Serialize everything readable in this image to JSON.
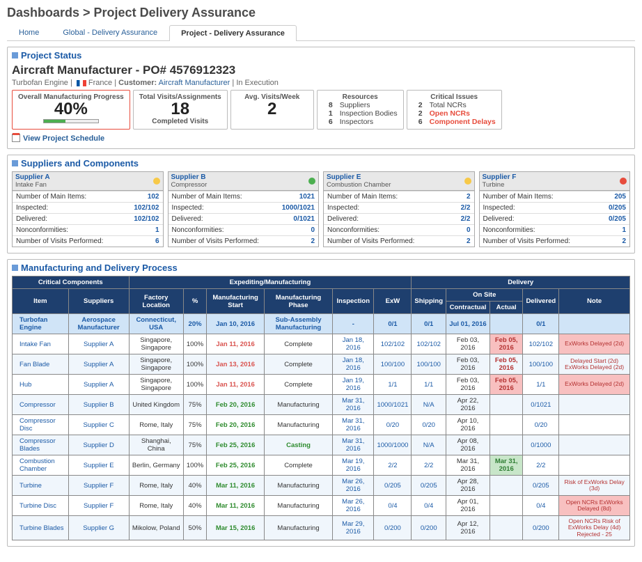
{
  "breadcrumb": "Dashboards > Project Delivery Assurance",
  "tabs": [
    {
      "label": "Home"
    },
    {
      "label": "Global - Delivery Assurance"
    },
    {
      "label": "Project - Delivery Assurance"
    }
  ],
  "sections": {
    "status_title": "Project Status",
    "suppliers_title": "Suppliers and Components",
    "process_title": "Manufacturing and Delivery Process"
  },
  "project": {
    "title": "Aircraft Manufacturer - PO# 4576912323",
    "engine": "Turbofan Engine",
    "country": "France",
    "cust_lbl": "Customer:",
    "customer": "Aircraft Manufacturer",
    "state": "In Execution",
    "schedule_link": "View Project Schedule"
  },
  "kpi": {
    "prog_lbl": "Overall Manufacturing Progress",
    "prog_val": "40%",
    "visits_lbl": "Total Visits/Assignments",
    "visits_val": "18",
    "visits_sub": "Completed Visits",
    "avg_lbl": "Avg. Visits/Week",
    "avg_val": "2",
    "res_lbl": "Resources",
    "res": [
      {
        "n": "8",
        "t": "Suppliers"
      },
      {
        "n": "1",
        "t": "Inspection Bodies"
      },
      {
        "n": "6",
        "t": "Inspectors"
      }
    ],
    "crit_lbl": "Critical Issues",
    "crit": [
      {
        "n": "2",
        "t": "Total NCRs",
        "red": false
      },
      {
        "n": "2",
        "t": "Open NCRs",
        "red": true
      },
      {
        "n": "6",
        "t": "Component Delays",
        "red": true
      }
    ]
  },
  "sup_labels": {
    "main": "Number of Main Items:",
    "insp": "Inspected:",
    "deliv": "Delivered:",
    "nonc": "Nonconformities:",
    "visits": "Number of Visits Performed:"
  },
  "suppliers": [
    {
      "name": "Supplier A",
      "comp": "Intake Fan",
      "dot": "y",
      "main": "102",
      "insp": "102/102",
      "deliv": "102/102",
      "nonc": "1",
      "visits": "6"
    },
    {
      "name": "Supplier B",
      "comp": "Compressor",
      "dot": "g",
      "main": "1021",
      "insp": "1000/1021",
      "deliv": "0/1021",
      "nonc": "0",
      "visits": "2"
    },
    {
      "name": "Supplier E",
      "comp": "Combustion Chamber",
      "dot": "y",
      "main": "2",
      "insp": "2/2",
      "deliv": "2/2",
      "nonc": "0",
      "visits": "2"
    },
    {
      "name": "Supplier F",
      "comp": "Turbine",
      "dot": "r",
      "main": "205",
      "insp": "0/205",
      "deliv": "0/205",
      "nonc": "1",
      "visits": "2"
    }
  ],
  "mdp_headers": {
    "g_crit": "Critical Components",
    "g_exp": "Expediting/Manufacturing",
    "g_del": "Delivery",
    "item": "Item",
    "sup": "Suppliers",
    "loc": "Factory Location",
    "pct": "%",
    "mstart": "Manufacturing Start",
    "mphase": "Manufacturing Phase",
    "insp": "Inspection",
    "exw": "ExW",
    "ship": "Shipping",
    "onsite": "On Site",
    "contr": "Contractual",
    "actual": "Actual",
    "deliv": "Delivered",
    "note": "Note"
  },
  "mdp_rows": [
    {
      "hd": true,
      "item": "Turbofan Engine",
      "sup": "Aerospace Manufacturer",
      "loc": "Connecticut, USA",
      "pct": "20%",
      "mstart": "Jan 10, 2016",
      "mphase": "Sub-Assembly Manufacturing",
      "insp": "-",
      "exw": "0/1",
      "ship": "0/1",
      "contr": "Jul 01, 2016",
      "actual": "",
      "deliv": "0/1",
      "note": ""
    },
    {
      "item": "Intake Fan",
      "sup": "Supplier A",
      "loc": "Singapore, Singapore",
      "pct": "100%",
      "mstart": "Jan 11, 2016",
      "mstart_r": true,
      "mphase": "Complete",
      "insp": "Jan 18, 2016",
      "exw": "102/102",
      "ship": "102/102",
      "contr": "Feb 03, 2016",
      "actual": "Feb 05, 2016",
      "actual_r": true,
      "deliv": "102/102",
      "note": "ExWorks Delayed (2d)"
    },
    {
      "item": "Fan Blade",
      "sup": "Supplier A",
      "loc": "Singapore, Singapore",
      "pct": "100%",
      "mstart": "Jan 13, 2016",
      "mstart_r": true,
      "mphase": "Complete",
      "insp": "Jan 18, 2016",
      "exw": "100/100",
      "ship": "100/100",
      "contr": "Feb 03, 2016",
      "actual": "Feb 05, 2016",
      "actual_r": true,
      "deliv": "100/100",
      "note": "Delayed Start (2d) ExWorks Delayed (2d)"
    },
    {
      "item": "Hub",
      "sup": "Supplier A",
      "loc": "Singapore, Singapore",
      "pct": "100%",
      "mstart": "Jan 11, 2016",
      "mstart_r": true,
      "mphase": "Complete",
      "insp": "Jan 19, 2016",
      "exw": "1/1",
      "ship": "1/1",
      "contr": "Feb 03, 2016",
      "actual": "Feb 05, 2016",
      "actual_r": true,
      "deliv": "1/1",
      "note": "ExWorks Delayed (2d)"
    },
    {
      "item": "Compressor",
      "sup": "Supplier B",
      "loc": "United Kingdom",
      "pct": "75%",
      "mstart": "Feb 20, 2016",
      "mphase": "Manufacturing",
      "insp": "Mar 31, 2016",
      "exw": "1000/1021",
      "ship": "N/A",
      "contr": "Apr 22, 2016",
      "actual": "",
      "deliv": "0/1021",
      "note": ""
    },
    {
      "item": "Compressor Disc",
      "sup": "Supplier C",
      "loc": "Rome, Italy",
      "pct": "75%",
      "mstart": "Feb 20, 2016",
      "mphase": "Manufacturing",
      "insp": "Mar 31, 2016",
      "exw": "0/20",
      "ship": "0/20",
      "contr": "Apr 10, 2016",
      "actual": "",
      "deliv": "0/20",
      "note": ""
    },
    {
      "item": "Compressor Blades",
      "sup": "Supplier D",
      "loc": "Shanghai, China",
      "pct": "75%",
      "mstart": "Feb 25, 2016",
      "mphase": "Casting",
      "mphase_g": true,
      "insp": "Mar 31, 2016",
      "exw": "1000/1000",
      "ship": "N/A",
      "contr": "Apr 08, 2016",
      "actual": "",
      "deliv": "0/1000",
      "note": ""
    },
    {
      "item": "Combustion Chamber",
      "sup": "Supplier E",
      "loc": "Berlin, Germany",
      "pct": "100%",
      "mstart": "Feb 25, 2016",
      "mphase": "Complete",
      "insp": "Mar 19, 2016",
      "exw": "2/2",
      "ship": "2/2",
      "contr": "Mar 31, 2016",
      "actual": "Mar 31, 2016",
      "actual_g": true,
      "deliv": "2/2",
      "note": ""
    },
    {
      "item": "Turbine",
      "sup": "Supplier F",
      "loc": "Rome, Italy",
      "pct": "40%",
      "mstart": "Mar 11, 2016",
      "mphase": "Manufacturing",
      "insp": "Mar 26, 2016",
      "exw": "0/205",
      "ship": "0/205",
      "contr": "Apr 28, 2016",
      "actual": "",
      "deliv": "0/205",
      "note": "Risk of ExWorks Delay (3d)"
    },
    {
      "item": "Turbine Disc",
      "sup": "Supplier F",
      "loc": "Rome, Italy",
      "pct": "40%",
      "mstart": "Mar 11, 2016",
      "mphase": "Manufacturing",
      "insp": "Mar 26, 2016",
      "exw": "0/4",
      "ship": "0/4",
      "contr": "Apr 01, 2016",
      "actual": "",
      "deliv": "0/4",
      "note": "Open NCRs ExWorks Delayed (8d)"
    },
    {
      "item": "Turbine Blades",
      "sup": "Supplier G",
      "loc": "Mikolow, Poland",
      "pct": "50%",
      "mstart": "Mar 15, 2016",
      "mphase": "Manufacturing",
      "insp": "Mar 29, 2016",
      "exw": "0/200",
      "ship": "0/200",
      "contr": "Apr 12, 2016",
      "actual": "",
      "deliv": "0/200",
      "note": "Open NCRs Risk of ExWorks Delay (4d) Rejected - 25"
    }
  ]
}
